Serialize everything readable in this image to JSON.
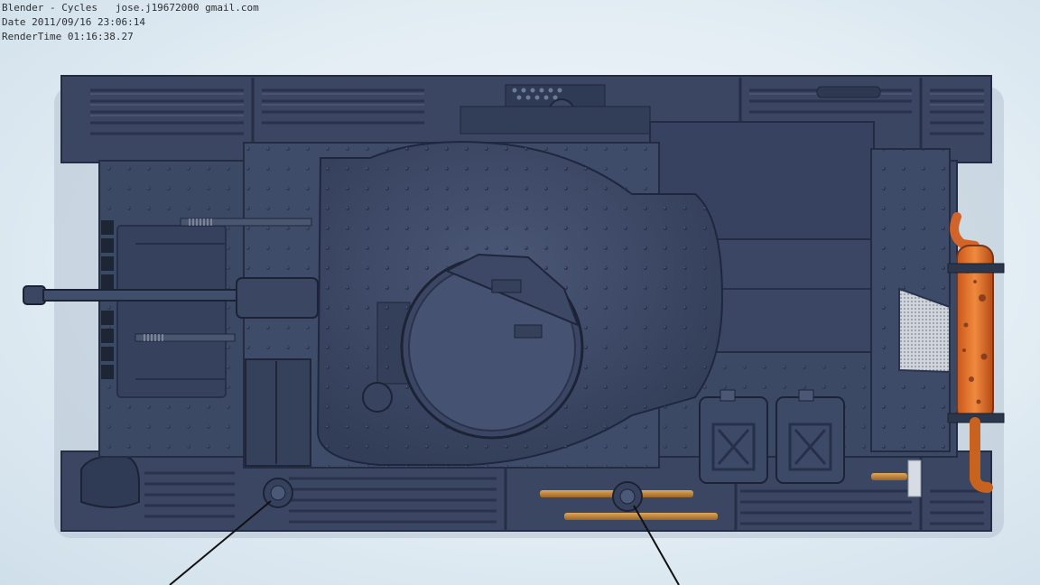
{
  "render_info": {
    "line1": "Blender - Cycles   jose.j19672000 gmail.com",
    "line2": "Date 2011/09/16 23:06:14",
    "line3": "RenderTime 01:16:38.27"
  },
  "colors": {
    "hull": "#3c4965",
    "hull_dark": "#2c364d",
    "hull_light": "#56637f",
    "muffler": "#e0742c",
    "rust": "#7a3418",
    "brass": "#c48a3a"
  }
}
